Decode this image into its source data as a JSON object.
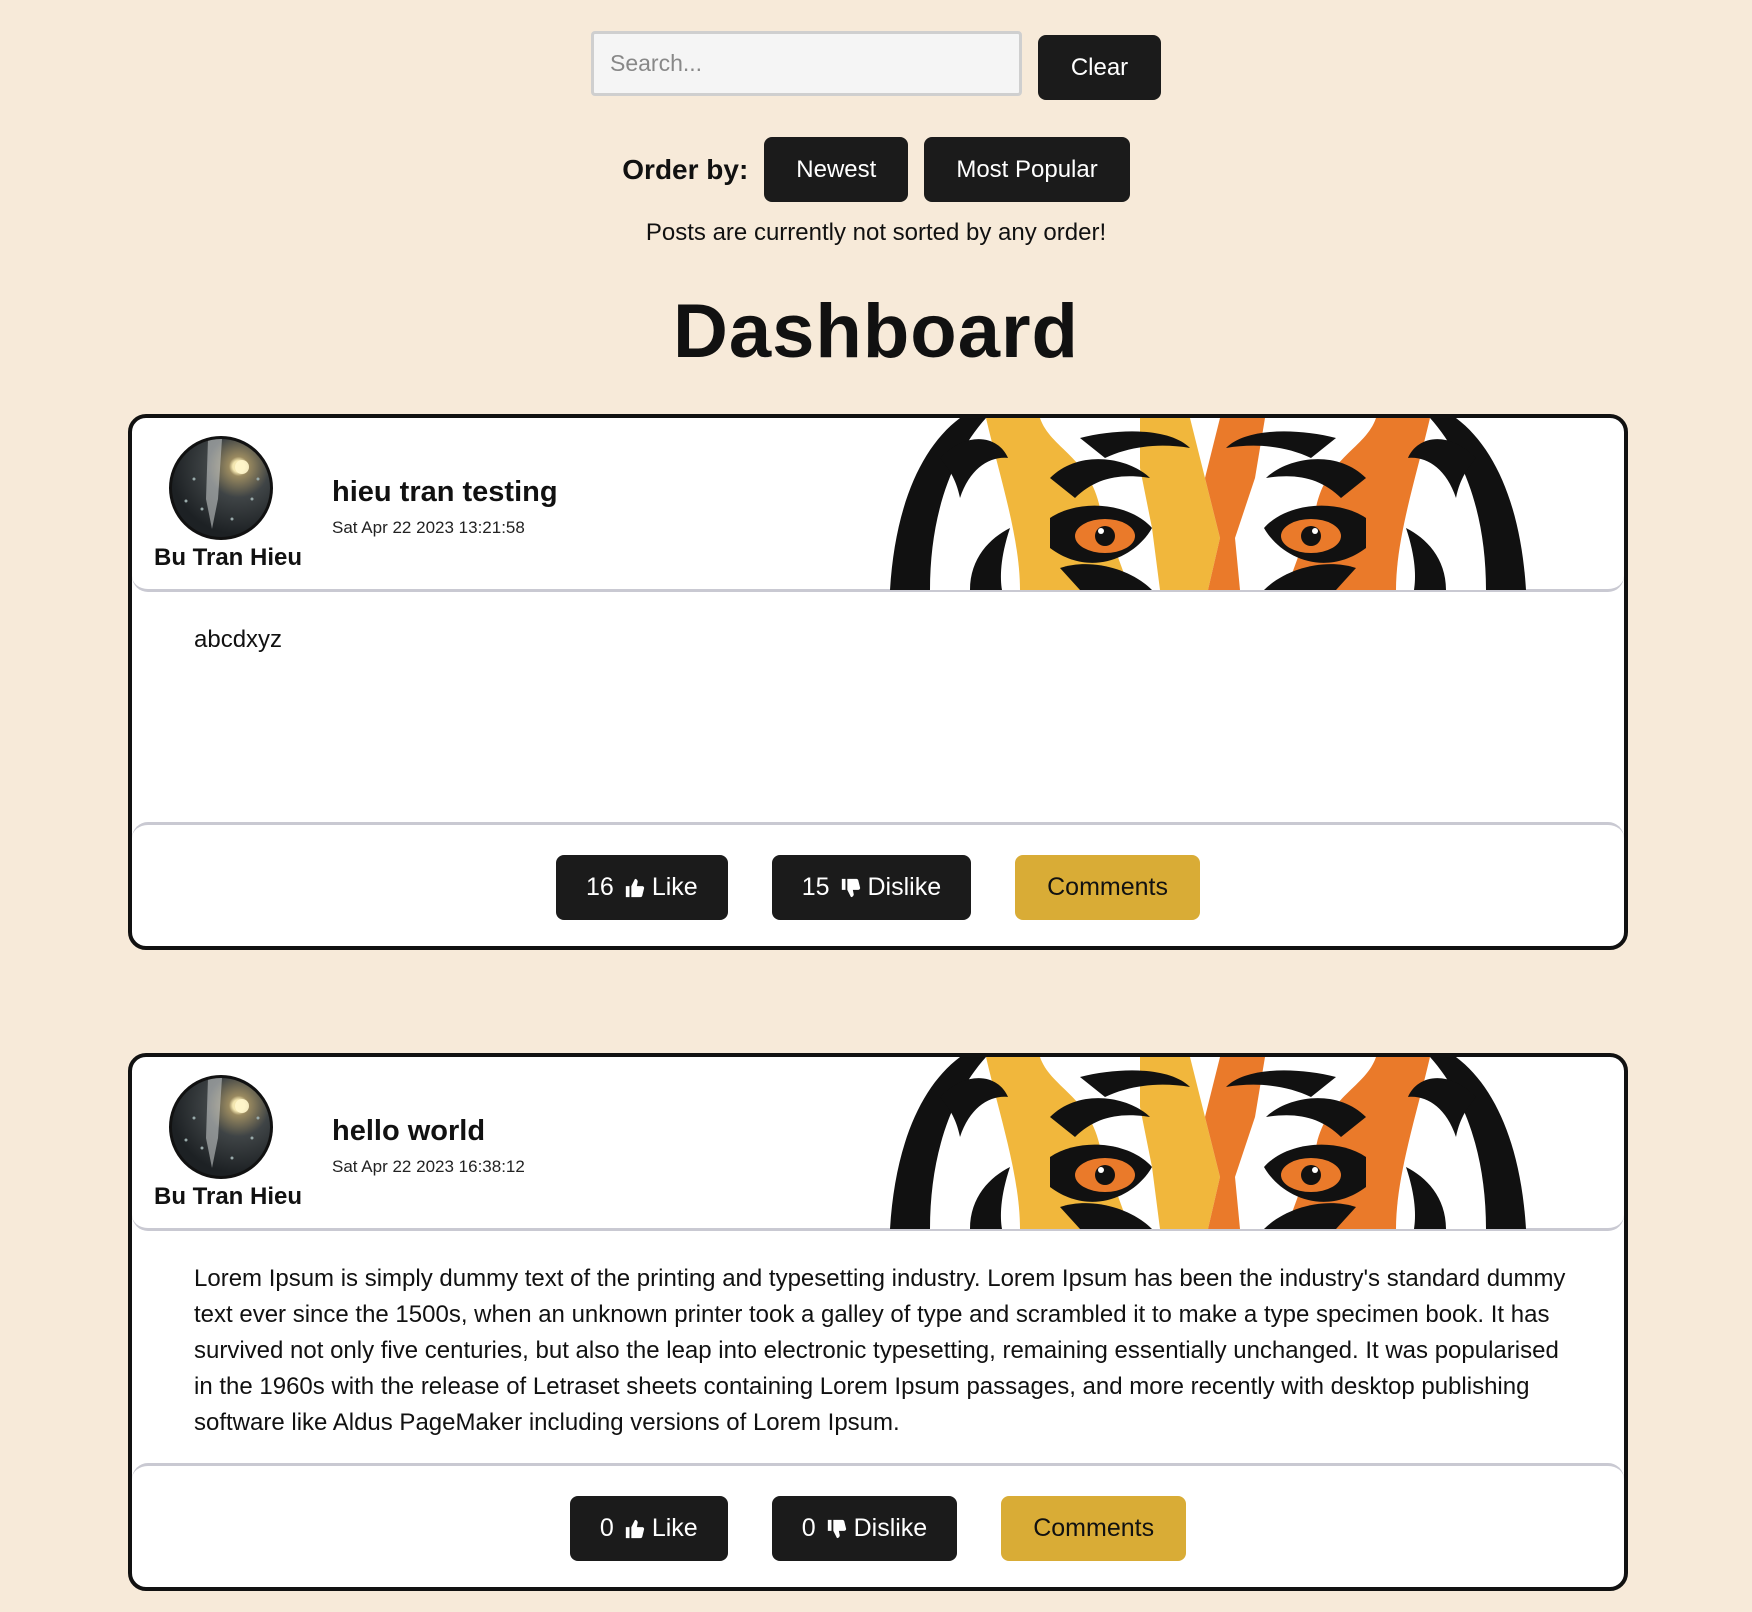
{
  "search": {
    "placeholder": "Search...",
    "clear_label": "Clear"
  },
  "order": {
    "label": "Order by:",
    "options": [
      "Newest",
      "Most Popular"
    ],
    "status": "Posts are currently not sorted by any order!"
  },
  "page_title": "Dashboard",
  "posts": [
    {
      "author": "Bu Tran Hieu",
      "title": "hieu tran testing",
      "date": "Sat Apr 22 2023 13:21:58",
      "body": "abcdxyz",
      "likes": "16",
      "like_label": "Like",
      "dislikes": "15",
      "dislike_label": "Dislike",
      "comments_label": "Comments"
    },
    {
      "author": "Bu Tran Hieu",
      "title": "hello world",
      "date": "Sat Apr 22 2023 16:38:12",
      "body": "Lorem Ipsum is simply dummy text of the printing and typesetting industry. Lorem Ipsum has been the industry's standard dummy text ever since the 1500s, when an unknown printer took a galley of type and scrambled it to make a type specimen book. It has survived not only five centuries, but also the leap into electronic typesetting, remaining essentially unchanged. It was popularised in the 1960s with the release of Letraset sheets containing Lorem Ipsum passages, and more recently with desktop publishing software like Aldus PageMaker including versions of Lorem Ipsum.",
      "likes": "0",
      "like_label": "Like",
      "dislikes": "0",
      "dislike_label": "Dislike",
      "comments_label": "Comments"
    }
  ],
  "colors": {
    "background": "#f7ead9",
    "button_dark": "#1b1b1b",
    "comments_button": "#d9ac36",
    "tiger_orange": "#ea7a2a",
    "tiger_yellow": "#f1b73c"
  },
  "icons": [
    "thumbs-up-icon",
    "thumbs-down-icon"
  ]
}
